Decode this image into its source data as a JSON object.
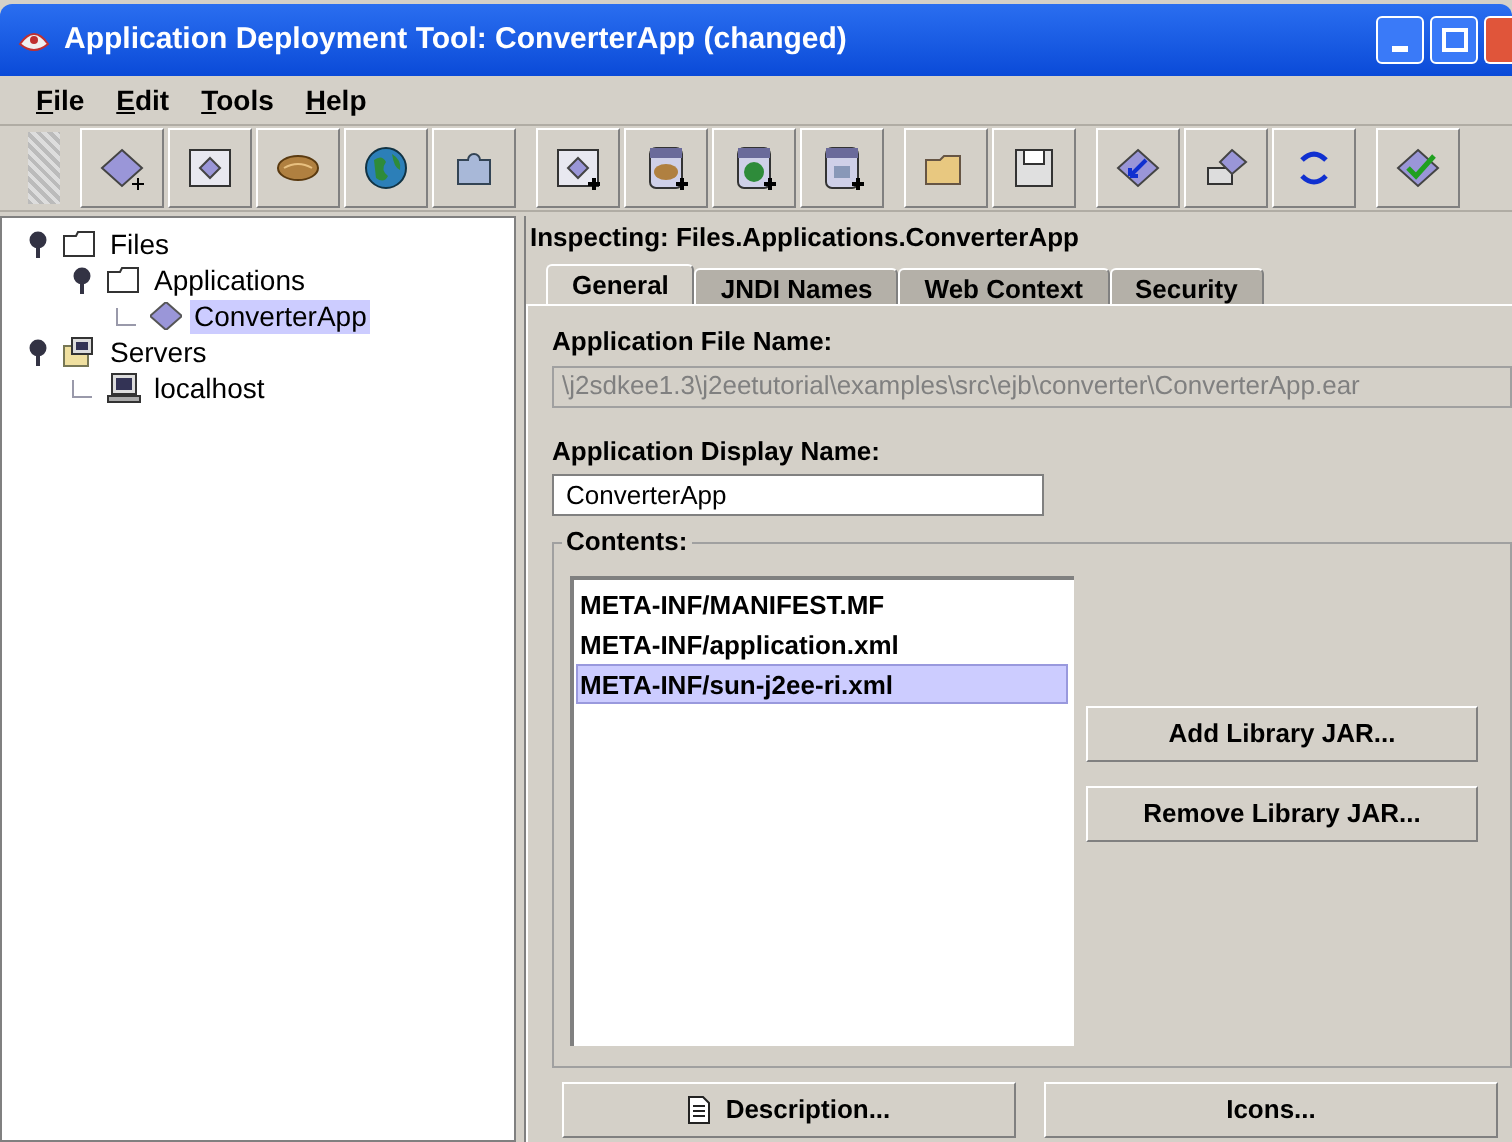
{
  "window": {
    "title": "Application Deployment Tool: ConverterApp (changed)"
  },
  "menu": [
    "File",
    "Edit",
    "Tools",
    "Help"
  ],
  "tree": [
    {
      "label": "Files",
      "kind": "folder",
      "expanded": true,
      "selected": false,
      "children": [
        {
          "label": "Applications",
          "kind": "folder",
          "expanded": true,
          "selected": false,
          "children": [
            {
              "label": "ConverterApp",
              "kind": "application",
              "selected": true
            }
          ]
        }
      ]
    },
    {
      "label": "Servers",
      "kind": "server",
      "expanded": true,
      "selected": false,
      "children": [
        {
          "label": "localhost",
          "kind": "host",
          "selected": false
        }
      ]
    }
  ],
  "inspector": {
    "heading": "Inspecting: Files.Applications.ConverterApp",
    "tabs": [
      {
        "label": "General",
        "selected": true
      },
      {
        "label": "JNDI Names",
        "selected": false
      },
      {
        "label": "Web Context",
        "selected": false
      },
      {
        "label": "Security",
        "selected": false
      }
    ],
    "file_name": {
      "label": "Application File Name:",
      "value": "\\j2sdkee1.3\\j2eetutorial\\examples\\src\\ejb\\converter\\ConverterApp.ear",
      "disabled": true
    },
    "display_name": {
      "label": "Application Display Name:",
      "value": "ConverterApp"
    },
    "contents": {
      "label": "Contents:",
      "items": [
        {
          "label": "META-INF/MANIFEST.MF",
          "selected": false
        },
        {
          "label": "META-INF/application.xml",
          "selected": false
        },
        {
          "label": "META-INF/sun-j2ee-ri.xml",
          "selected": true
        }
      ],
      "buttons": [
        "Add Library JAR...",
        "Remove Library JAR..."
      ]
    },
    "bottom_buttons": [
      {
        "label": "Description...",
        "kind": "document"
      },
      {
        "label": "Icons...",
        "kind": "plain"
      }
    ]
  }
}
